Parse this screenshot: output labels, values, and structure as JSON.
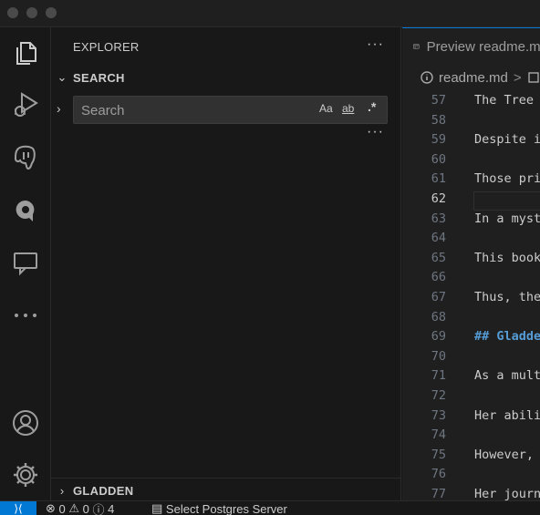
{
  "sidebar": {
    "title": "EXPLORER",
    "more": "···",
    "search_section": {
      "label": "SEARCH"
    },
    "search": {
      "placeholder": "Search",
      "value": "",
      "opt_case": "Aa",
      "opt_word": "ab",
      "opt_regex": ".*"
    },
    "search_more": "···",
    "bottom_section": {
      "label": "GLADDEN"
    }
  },
  "editor": {
    "tab_label": "Preview readme.md",
    "breadcrumb": {
      "file": "readme.md",
      "separator": ">"
    },
    "lines": [
      {
        "n": "57",
        "text": "The Tree"
      },
      {
        "n": "58",
        "text": ""
      },
      {
        "n": "59",
        "text": "Despite i"
      },
      {
        "n": "60",
        "text": ""
      },
      {
        "n": "61",
        "text": "Those pri"
      },
      {
        "n": "62",
        "text": ""
      },
      {
        "n": "63",
        "text": "In a myst"
      },
      {
        "n": "64",
        "text": ""
      },
      {
        "n": "65",
        "text": "This book"
      },
      {
        "n": "66",
        "text": ""
      },
      {
        "n": "67",
        "text": "Thus, the"
      },
      {
        "n": "68",
        "text": ""
      },
      {
        "n": "69",
        "text": "## Gladde"
      },
      {
        "n": "70",
        "text": ""
      },
      {
        "n": "71",
        "text": "As a mult"
      },
      {
        "n": "72",
        "text": ""
      },
      {
        "n": "73",
        "text": "Her abili"
      },
      {
        "n": "74",
        "text": ""
      },
      {
        "n": "75",
        "text": "However, "
      },
      {
        "n": "76",
        "text": ""
      },
      {
        "n": "77",
        "text": "Her journ"
      }
    ],
    "active_line": "62"
  },
  "statusbar": {
    "errors": "0",
    "warnings": "0",
    "info": "4",
    "postgres": "Select Postgres Server"
  },
  "colors": {
    "accent": "#0078d4",
    "heading": "#569cd6"
  }
}
